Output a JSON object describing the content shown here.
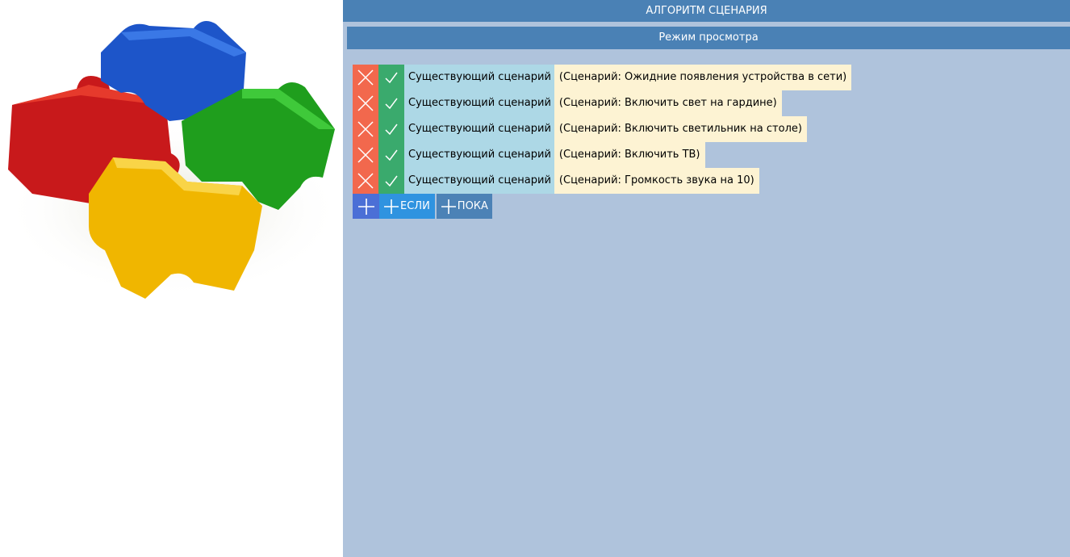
{
  "header": {
    "title": "АЛГОРИТМ СЦЕНАРИЯ",
    "mode": "Режим просмотра"
  },
  "steps": [
    {
      "type": "Существующий сценарий",
      "description": "(Сценарий: Ожидние появления устройства в сети)"
    },
    {
      "type": "Существующий сценарий",
      "description": "(Сценарий: Включить свет на гардине)"
    },
    {
      "type": "Существующий сценарий",
      "description": "(Сценарий: Включить светильник на столе)"
    },
    {
      "type": "Существующий сценарий",
      "description": "(Сценарий: Включить ТВ)"
    },
    {
      "type": "Существующий сценарий",
      "description": "(Сценарий: Громкость звука на 10)"
    }
  ],
  "add_buttons": {
    "if_label": "ЕСЛИ",
    "while_label": "ПОКА"
  },
  "icons": {
    "logo": "puzzle-logo-icon",
    "delete": "close-icon",
    "confirm": "checkmark-icon",
    "add": "plus-icon"
  },
  "colors": {
    "header_bg": "#4a81b5",
    "pane_bg": "#afc3dc",
    "delete_bg": "#f2684d",
    "confirm_bg": "#3aaa6d",
    "step_type_bg": "#add8e6",
    "step_desc_bg": "#fdf3d3",
    "add_bg": "#4b6fd6",
    "add_if_bg": "#2f93e0",
    "add_while_bg": "#4c82b6"
  }
}
